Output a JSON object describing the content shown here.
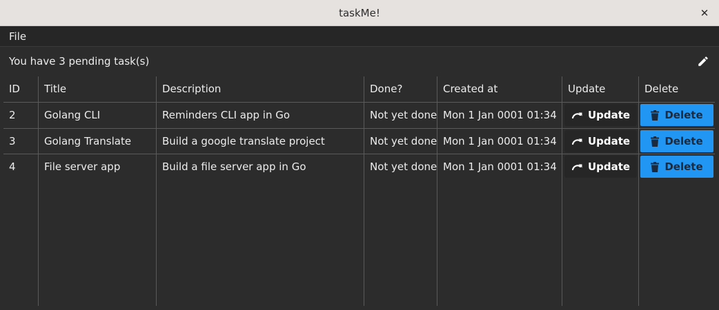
{
  "window": {
    "title": "taskMe!",
    "close_glyph": "✕"
  },
  "menu": {
    "file_label": "File"
  },
  "status": {
    "text": "You have 3 pending task(s)"
  },
  "table": {
    "headers": [
      "ID",
      "Title",
      "Description",
      "Done?",
      "Created at",
      "Update",
      "Delete"
    ],
    "rows": [
      {
        "id": "2",
        "title": "Golang CLI",
        "description": "Reminders CLI app in Go",
        "done": "Not yet done",
        "created": "Mon 1 Jan 0001 01:34"
      },
      {
        "id": "3",
        "title": "Golang Translate",
        "description": "Build a google translate project",
        "done": "Not yet done",
        "created": "Mon 1 Jan 0001 01:34"
      },
      {
        "id": "4",
        "title": "File server app",
        "description": "Build a file server app in Go",
        "done": "Not yet done",
        "created": "Mon 1 Jan 0001 01:34"
      }
    ],
    "update_label": "Update",
    "delete_label": "Delete"
  },
  "icons": {
    "edit": "pencil-icon",
    "update": "redo-arrow-icon",
    "delete": "trash-icon"
  },
  "colors": {
    "delete_button": "#2196f3",
    "background": "#2c2c2c"
  }
}
